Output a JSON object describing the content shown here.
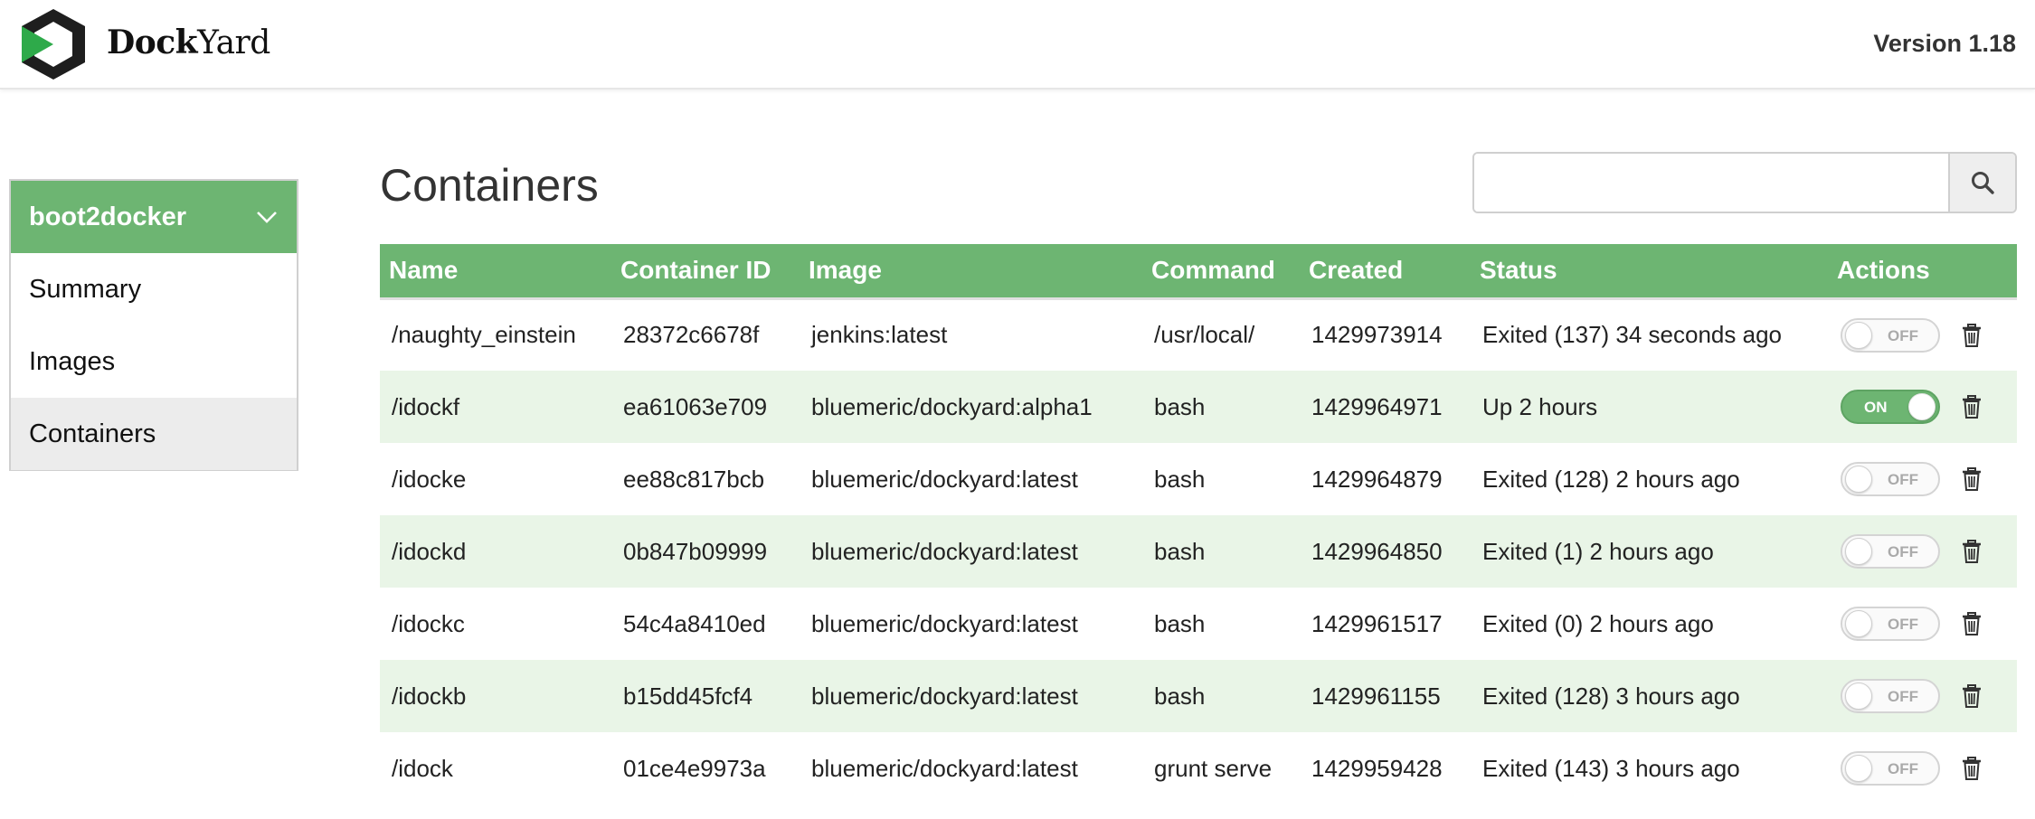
{
  "app": {
    "brand_part1": "Dock",
    "brand_part2": "Yard",
    "version": "Version 1.18",
    "accent_color": "#6db572",
    "stripe_color": "#e9f5e7"
  },
  "sidebar": {
    "host": "boot2docker",
    "items": [
      {
        "label": "Summary",
        "active": false
      },
      {
        "label": "Images",
        "active": false
      },
      {
        "label": "Containers",
        "active": true
      }
    ]
  },
  "main": {
    "title": "Containers",
    "search": {
      "value": "",
      "placeholder": ""
    },
    "columns": [
      "Name",
      "Container ID",
      "Image",
      "Command",
      "Created",
      "Status",
      "Actions"
    ],
    "rows": [
      {
        "name": "/naughty_einstein",
        "id": "28372c6678f",
        "image": "jenkins:latest",
        "command": "/usr/local/",
        "created": "1429973914",
        "status": "Exited (137) 34 seconds ago",
        "toggle": "OFF"
      },
      {
        "name": "/idockf",
        "id": "ea61063e709",
        "image": "bluemeric/dockyard:alpha1",
        "command": "bash",
        "created": "1429964971",
        "status": "Up 2 hours",
        "toggle": "ON"
      },
      {
        "name": "/idocke",
        "id": "ee88c817bcb",
        "image": "bluemeric/dockyard:latest",
        "command": "bash",
        "created": "1429964879",
        "status": "Exited (128) 2 hours ago",
        "toggle": "OFF"
      },
      {
        "name": "/idockd",
        "id": "0b847b09999",
        "image": "bluemeric/dockyard:latest",
        "command": "bash",
        "created": "1429964850",
        "status": "Exited (1) 2 hours ago",
        "toggle": "OFF"
      },
      {
        "name": "/idockc",
        "id": "54c4a8410ed",
        "image": "bluemeric/dockyard:latest",
        "command": "bash",
        "created": "1429961517",
        "status": "Exited (0) 2 hours ago",
        "toggle": "OFF"
      },
      {
        "name": "/idockb",
        "id": "b15dd45fcf4",
        "image": "bluemeric/dockyard:latest",
        "command": "bash",
        "created": "1429961155",
        "status": "Exited (128) 3 hours ago",
        "toggle": "OFF"
      },
      {
        "name": "/idock",
        "id": "01ce4e9973a",
        "image": "bluemeric/dockyard:latest",
        "command": "grunt serve",
        "created": "1429959428",
        "status": "Exited (143) 3 hours ago",
        "toggle": "OFF"
      }
    ]
  },
  "icons": {
    "logo": "dockyard-logo-icon",
    "chevron": "chevron-down-icon",
    "search": "search-icon",
    "trash": "trash-icon"
  }
}
